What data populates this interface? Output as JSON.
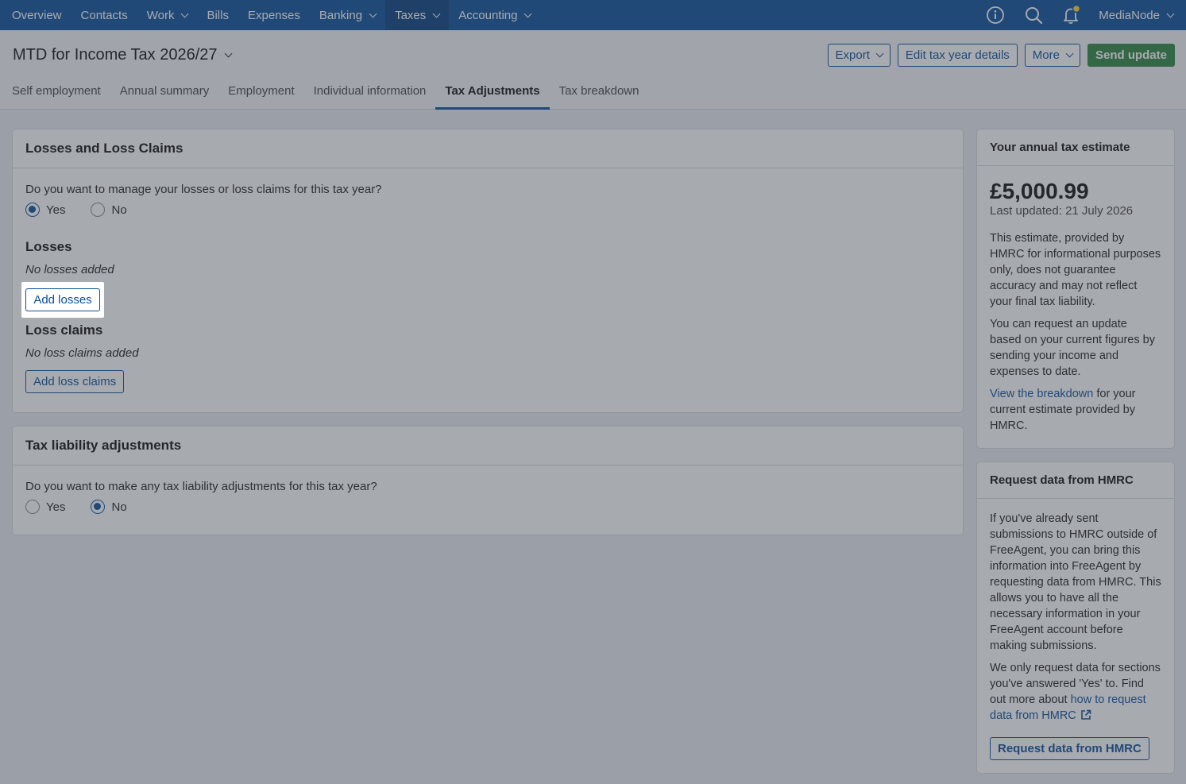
{
  "nav": {
    "items": [
      {
        "label": "Overview",
        "dropdown": false,
        "active": false
      },
      {
        "label": "Contacts",
        "dropdown": false,
        "active": false
      },
      {
        "label": "Work",
        "dropdown": true,
        "active": false
      },
      {
        "label": "Bills",
        "dropdown": false,
        "active": false
      },
      {
        "label": "Expenses",
        "dropdown": false,
        "active": false
      },
      {
        "label": "Banking",
        "dropdown": true,
        "active": false
      },
      {
        "label": "Taxes",
        "dropdown": true,
        "active": true
      },
      {
        "label": "Accounting",
        "dropdown": true,
        "active": false
      }
    ],
    "user": "MediaNode",
    "icons": [
      "info-icon",
      "search-icon",
      "bell-icon"
    ]
  },
  "header": {
    "title": "MTD for Income Tax 2026/27",
    "actions": {
      "export": "Export",
      "edit": "Edit tax year details",
      "more": "More",
      "send": "Send update"
    },
    "tabs": [
      {
        "label": "Self employment",
        "active": false
      },
      {
        "label": "Annual summary",
        "active": false
      },
      {
        "label": "Employment",
        "active": false
      },
      {
        "label": "Individual information",
        "active": false
      },
      {
        "label": "Tax Adjustments",
        "active": true
      },
      {
        "label": "Tax breakdown",
        "active": false
      }
    ]
  },
  "losses_card": {
    "title": "Losses and Loss Claims",
    "question": "Do you want to manage your losses or loss claims for this tax year?",
    "yes": "Yes",
    "no": "No",
    "selected": "Yes",
    "losses_heading": "Losses",
    "losses_empty": "No losses added",
    "add_losses": "Add losses",
    "claims_heading": "Loss claims",
    "claims_empty": "No loss claims added",
    "add_claims": "Add loss claims"
  },
  "liability_card": {
    "title": "Tax liability adjustments",
    "question": "Do you want to make any tax liability adjustments for this tax year?",
    "yes": "Yes",
    "no": "No",
    "selected": "No"
  },
  "estimate_card": {
    "title": "Your annual tax estimate",
    "amount": "£5,000.99",
    "updated": "Last updated: 21 July 2026",
    "para1": "This estimate, provided by HMRC for informational purposes only, does not guarantee accuracy and may not reflect your final tax liability.",
    "para2": "You can request an update based on your current figures by sending your income and expenses to date.",
    "link": "View the breakdown",
    "para3_rest": " for your current estimate provided by HMRC."
  },
  "hmrc_card": {
    "title": "Request data from HMRC",
    "para1": "If you've already sent submissions to HMRC outside of FreeAgent, you can bring this information into FreeAgent by requesting data from HMRC. This allows you to have all the necessary information in your FreeAgent account before making submissions.",
    "para2_start": "We only request data for sections you've answered 'Yes' to. Find out more about ",
    "link": "how to request data from HMRC",
    "button": "Request data from HMRC"
  },
  "colors": {
    "nav_bg": "#0b4f9c",
    "accent": "#0b4f9c",
    "send_update": "#2e8540"
  }
}
